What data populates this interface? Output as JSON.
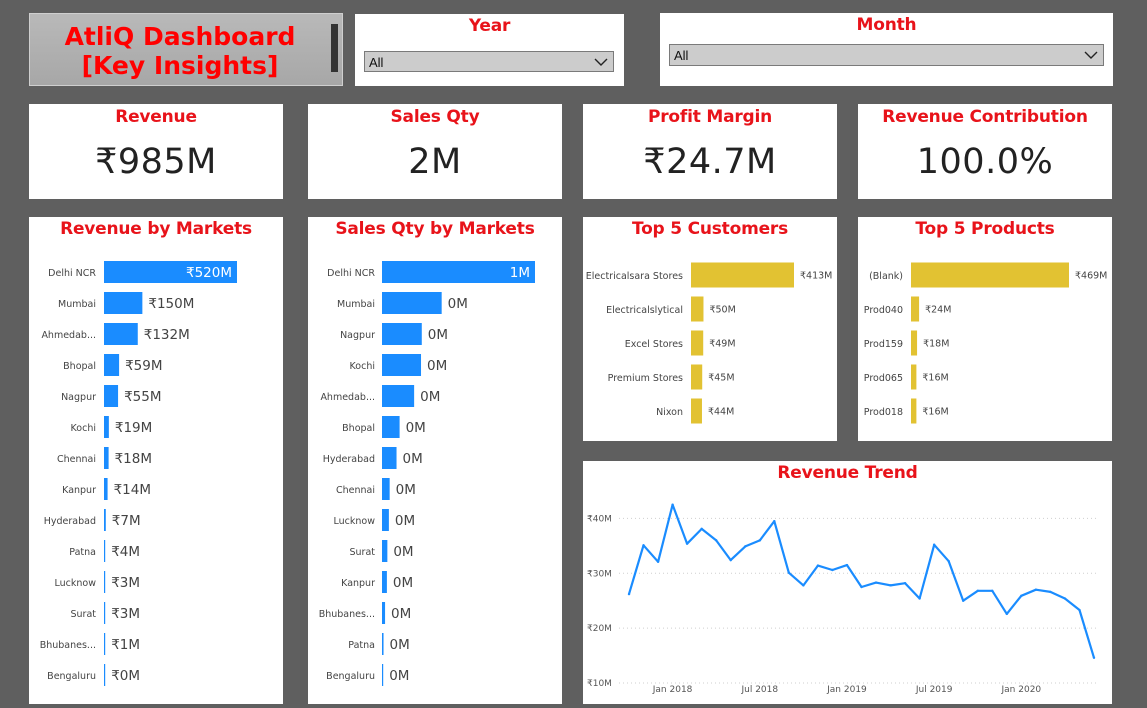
{
  "title": {
    "line1": "AtliQ  Dashboard",
    "line2": "[Key Insights]"
  },
  "slicers": {
    "year": {
      "label": "Year",
      "value": "All"
    },
    "month": {
      "label": "Month",
      "value": "All"
    }
  },
  "kpis": {
    "revenue": {
      "label": "Revenue",
      "value": "₹985M"
    },
    "sales_qty": {
      "label": "Sales Qty",
      "value": "2M"
    },
    "profit_margin": {
      "label": "Profit Margin",
      "value": "₹24.7M"
    },
    "revenue_contribution": {
      "label": "Revenue Contribution",
      "value": "100.0%"
    }
  },
  "colors": {
    "accent": "#e8131a",
    "blue": "#1a8cff",
    "gold": "#e2c232",
    "panel": "#ffffff",
    "background": "#5f5f5f"
  },
  "chart_data": [
    {
      "id": "revenue_by_markets",
      "type": "bar",
      "title": "Revenue by Markets",
      "categories": [
        "Delhi NCR",
        "Mumbai",
        "Ahmedab...",
        "Bhopal",
        "Nagpur",
        "Kochi",
        "Chennai",
        "Kanpur",
        "Hyderabad",
        "Patna",
        "Lucknow",
        "Surat",
        "Bhubanes...",
        "Bengaluru"
      ],
      "values": [
        520,
        150,
        132,
        59,
        55,
        19,
        18,
        14,
        7,
        4,
        3,
        3,
        1,
        0.3
      ],
      "labels": [
        "₹520M",
        "₹150M",
        "₹132M",
        "₹59M",
        "₹55M",
        "₹19M",
        "₹18M",
        "₹14M",
        "₹7M",
        "₹4M",
        "₹3M",
        "₹3M",
        "₹1M",
        "₹0M"
      ]
    },
    {
      "id": "sales_qty_by_markets",
      "type": "bar",
      "title": "Sales Qty by Markets",
      "categories": [
        "Delhi NCR",
        "Mumbai",
        "Nagpur",
        "Kochi",
        "Ahmedab...",
        "Bhopal",
        "Hyderabad",
        "Chennai",
        "Lucknow",
        "Surat",
        "Kanpur",
        "Bhubanes...",
        "Patna",
        "Bengaluru"
      ],
      "values": [
        1000,
        390,
        260,
        255,
        210,
        115,
        95,
        50,
        45,
        35,
        32,
        20,
        10,
        3
      ],
      "labels": [
        "1M",
        "0M",
        "0M",
        "0M",
        "0M",
        "0M",
        "0M",
        "0M",
        "0M",
        "0M",
        "0M",
        "0M",
        "0M",
        "0M"
      ]
    },
    {
      "id": "top5_customers",
      "type": "bar",
      "title": "Top 5 Customers",
      "categories": [
        "Electricalsara Stores",
        "Electricalslytical",
        "Excel Stores",
        "Premium Stores",
        "Nixon"
      ],
      "values": [
        413,
        50,
        49,
        45,
        44
      ],
      "labels": [
        "₹413M",
        "₹50M",
        "₹49M",
        "₹45M",
        "₹44M"
      ]
    },
    {
      "id": "top5_products",
      "type": "bar",
      "title": "Top 5 Products",
      "categories": [
        "(Blank)",
        "Prod040",
        "Prod159",
        "Prod065",
        "Prod018"
      ],
      "values": [
        469,
        24,
        18,
        16,
        16
      ],
      "labels": [
        "₹469M",
        "₹24M",
        "₹18M",
        "₹16M",
        "₹16M"
      ]
    },
    {
      "id": "revenue_trend",
      "type": "line",
      "title": "Revenue Trend",
      "x": [
        "2017-10",
        "2017-11",
        "2017-12",
        "2018-01",
        "2018-02",
        "2018-03",
        "2018-04",
        "2018-05",
        "2018-06",
        "2018-07",
        "2018-08",
        "2018-09",
        "2018-10",
        "2018-11",
        "2018-12",
        "2019-01",
        "2019-02",
        "2019-03",
        "2019-04",
        "2019-05",
        "2019-06",
        "2019-07",
        "2019-08",
        "2019-09",
        "2019-10",
        "2019-11",
        "2019-12",
        "2020-01",
        "2020-02",
        "2020-03",
        "2020-04",
        "2020-05",
        "2020-06"
      ],
      "y": [
        26.2,
        35.1,
        32.1,
        42.5,
        35.4,
        38.1,
        36.0,
        32.4,
        34.9,
        36.0,
        39.5,
        30.1,
        27.8,
        31.4,
        30.6,
        31.5,
        27.5,
        28.3,
        27.8,
        28.2,
        25.4,
        35.2,
        32.2,
        25.0,
        26.8,
        26.8,
        22.6,
        25.9,
        27.0,
        26.6,
        25.4,
        23.3,
        14.6
      ],
      "ylim": [
        10,
        45
      ],
      "yticks": [
        10,
        20,
        30,
        40
      ],
      "ytick_labels": [
        "₹10M",
        "₹20M",
        "₹30M",
        "₹40M"
      ],
      "xtick_labels": [
        {
          "at": "2018-01",
          "label": "Jan 2018"
        },
        {
          "at": "2018-07",
          "label": "Jul 2018"
        },
        {
          "at": "2019-01",
          "label": "Jan 2019"
        },
        {
          "at": "2019-07",
          "label": "Jul 2019"
        },
        {
          "at": "2020-01",
          "label": "Jan 2020"
        }
      ],
      "grid": true
    }
  ]
}
